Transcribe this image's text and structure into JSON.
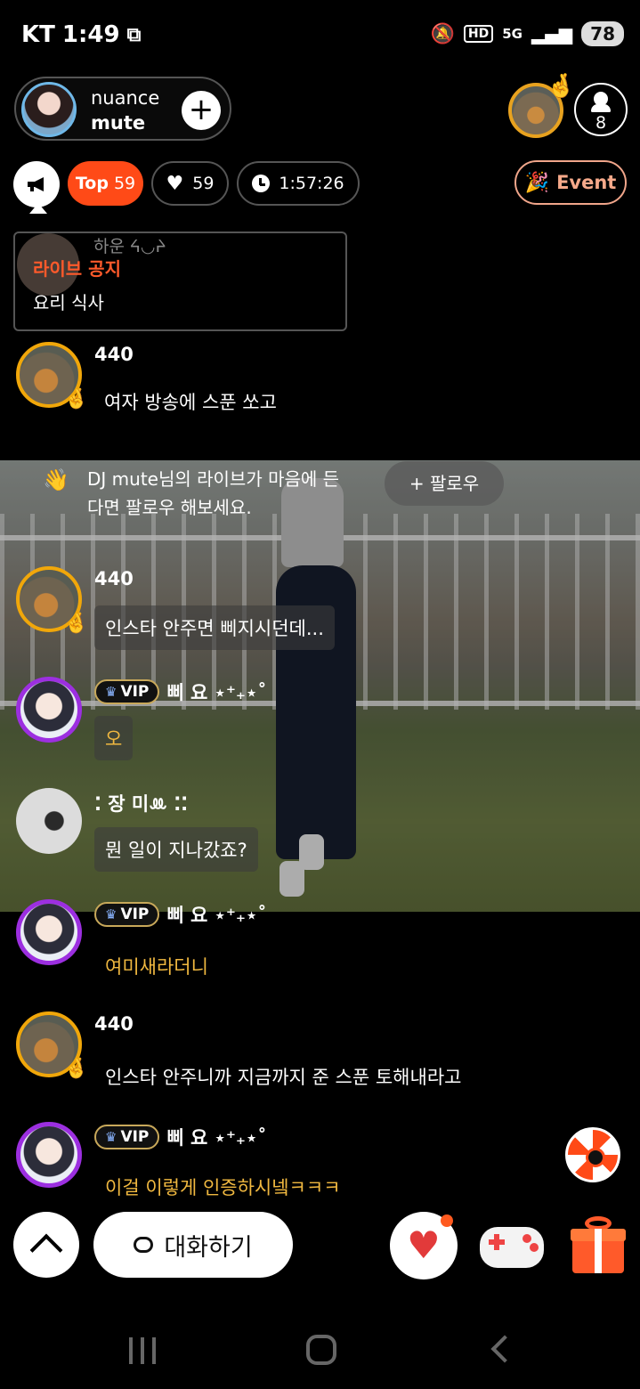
{
  "status_bar": {
    "carrier": "KT",
    "time": "1:49",
    "hd": "HD",
    "network": "5G",
    "battery": "78"
  },
  "host": {
    "name": "nuance",
    "dj": "mute",
    "add_icon": "plus-icon"
  },
  "top_fan": {
    "badge_icon": "hand-badge-icon"
  },
  "viewers": {
    "count": "8",
    "icon": "person-icon"
  },
  "stats": {
    "top_label": "Top",
    "top_rank": "59",
    "likes": "59",
    "duration": "1:57:26",
    "event_label": "Event"
  },
  "notice": {
    "title": "라이브 공지",
    "body": "요리 식사",
    "ghost_name": "하운 ᔦ◡ᔨ"
  },
  "follow_prompt": {
    "text": "DJ mute님의 라이브가 마음에 든다면 팔로우 해보세요.",
    "button": "+ 팔로우"
  },
  "chat": [
    {
      "nick": "440",
      "vip": false,
      "avatar": "dog",
      "message": "여자 방송에 스푼 쏘고",
      "style": "plain"
    },
    {
      "nick": "440",
      "vip": false,
      "avatar": "dog",
      "message": "인스타 안주면 삐지시던데...",
      "style": "box"
    },
    {
      "nick": "삐 요 ⋆⁺₊⋆˚",
      "vip": true,
      "avatar": "vip",
      "message": "오",
      "style": "box-gold"
    },
    {
      "nick": "⁚ 장 미ꔛ ⁚⁚",
      "vip": false,
      "avatar": "photo",
      "message": "뭔 일이 지나갔죠?",
      "style": "box"
    },
    {
      "nick": "삐 요 ⋆⁺₊⋆˚",
      "vip": true,
      "avatar": "vip",
      "message": "여미새라더니",
      "style": "gold"
    },
    {
      "nick": "440",
      "vip": false,
      "avatar": "dog",
      "message": "인스타 안주니까 지금까지 준 스푼 토해내라고",
      "style": "plain"
    },
    {
      "nick": "삐 요 ⋆⁺₊⋆˚",
      "vip": true,
      "avatar": "vip",
      "message": "이걸 이렇게 인증하시넼ㅋㅋㅋ",
      "style": "gold"
    }
  ],
  "vip_label": "VIP",
  "bottom": {
    "chat_button": "대화하기"
  },
  "colors": {
    "accent": "#ff4a17",
    "gold_text": "#f0b840",
    "vip_ring": "#9c2fe0",
    "fan_ring": "#f1a70a"
  }
}
